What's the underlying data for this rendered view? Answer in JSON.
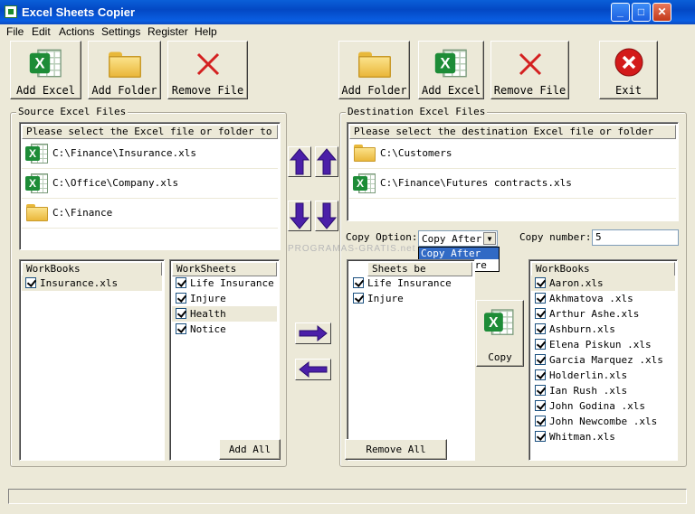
{
  "window": {
    "title": "Excel Sheets Copier",
    "controls": {
      "minimize": "_",
      "maximize": "□",
      "close": "✕"
    }
  },
  "menu": [
    "File",
    "Edit",
    "Actions",
    "Settings",
    "Register",
    "Help"
  ],
  "toolbar_left": {
    "add_excel": "Add Excel",
    "add_folder": "Add Folder",
    "remove_file": "Remove File"
  },
  "toolbar_right": {
    "add_folder": "Add Folder",
    "add_excel": "Add Excel",
    "remove_file": "Remove File",
    "exit": "Exit"
  },
  "source": {
    "legend": "Source Excel Files",
    "header": "Please select the Excel file or folder to copy",
    "files": [
      {
        "icon": "excel-file-icon",
        "path": "C:\\Finance\\Insurance.xls"
      },
      {
        "icon": "excel-file-icon",
        "path": "C:\\Office\\Company.xls"
      },
      {
        "icon": "folder-icon",
        "path": "C:\\Finance"
      }
    ],
    "workbooks_header": "WorkBooks",
    "workbooks": [
      "Insurance.xls"
    ],
    "worksheets_header": "WorkSheets",
    "worksheets": [
      "Life Insurance",
      "Injure",
      "Health",
      "Notice"
    ],
    "add_all": "Add All"
  },
  "destination": {
    "legend": "Destination Excel Files",
    "header": "Please select the destination Excel file or folder",
    "files": [
      {
        "icon": "folder-icon",
        "path": "C:\\Customers"
      },
      {
        "icon": "excel-file-icon",
        "path": "C:\\Finance\\Futures contracts.xls"
      }
    ],
    "copy_option_label": "Copy Option:",
    "copy_option_value": "Copy After",
    "copy_option_list": [
      "Copy After",
      "Copy Before"
    ],
    "copy_number_label": "Copy number:",
    "copy_number_value": "5",
    "sheets_header": "Sheets be",
    "sheets": [
      "Life Insurance",
      "Injure"
    ],
    "remove_all": "Remove All",
    "copy": "Copy",
    "workbooks_header": "WorkBooks",
    "workbooks": [
      "Aaron.xls",
      "Akhmatova .xls",
      "Arthur Ashe.xls",
      "Ashburn.xls",
      "Elena Piskun .xls",
      "Garcia Marquez .xls",
      "Holderlin.xls",
      "Ian Rush .xls",
      "John Godina .xls",
      "John Newcombe .xls",
      "Whitman.xls"
    ]
  },
  "watermark": "PROGRAMAS-GRATIS.net",
  "colors": {
    "titlebar": "#0348c4",
    "face": "#ece9d8",
    "excel_green": "#1d8c37",
    "arrow_purple": "#4b1fa8",
    "exit_red": "#d31a1a"
  }
}
